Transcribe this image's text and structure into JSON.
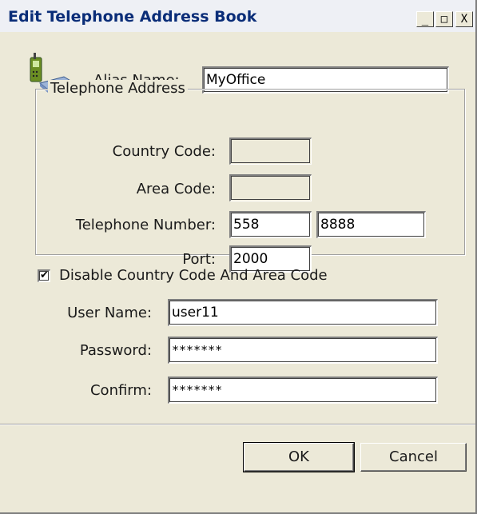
{
  "window": {
    "title": "Edit Telephone Address Book",
    "minimize_glyph": "_",
    "maximize_glyph": "□",
    "close_glyph": "X"
  },
  "alias": {
    "label": "Alias Name:",
    "value": "MyOffice",
    "icon": "phone-modem-icon"
  },
  "telephone_group": {
    "title": "Telephone Address",
    "country_code_label": "Country Code:",
    "country_code_value": "",
    "area_code_label": "Area Code:",
    "area_code_value": "",
    "number_label": "Telephone Number:",
    "number_part1": "558",
    "number_part2": "8888",
    "port_label": "Port:",
    "port_value": "2000"
  },
  "disable_codes": {
    "label": "Disable Country Code And Area Code",
    "checked": true
  },
  "credentials": {
    "user_label": "User Name:",
    "user_value": "user11",
    "password_label": "Password:",
    "password_value": "*******",
    "confirm_label": "Confirm:",
    "confirm_value": "*******"
  },
  "buttons": {
    "ok": "OK",
    "cancel": "Cancel"
  }
}
